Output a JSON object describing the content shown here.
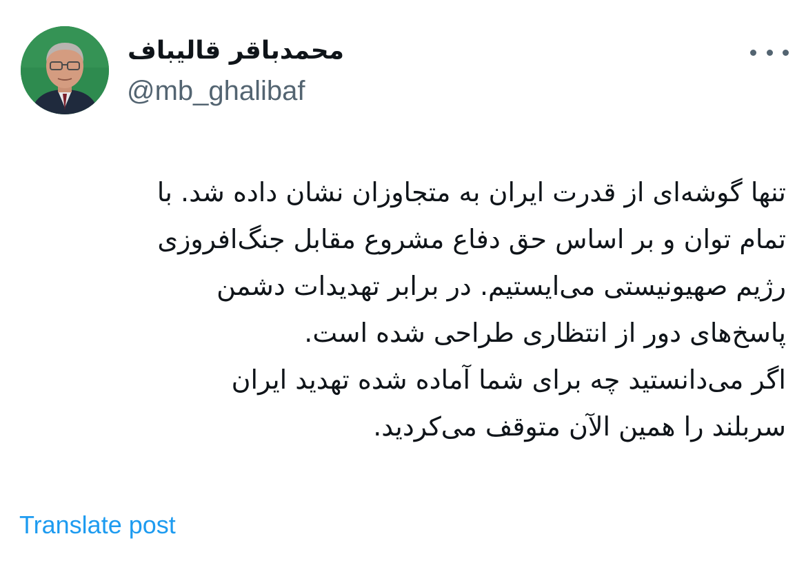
{
  "author": {
    "display_name": "محمدباقر قالیباف",
    "handle": "@mb_ghalibaf",
    "avatar": "profile-photo"
  },
  "post": {
    "lines": [
      "تنها گوشه‌ای از قدرت ایران به متجاوزان نشان داده شد. با",
      "تمام توان و بر اساس حق دفاع مشروع مقابل جنگ‌افروزی",
      "رژیم صهیونیستی می‌ایستیم. در برابر تهدیدات دشمن",
      "پاسخ‌های دور از انتظاری طراحی شده است.",
      "اگر می‌دانستید چه برای شما آماده شده تهدید ایران",
      "سربلند را همین الآن متوقف می‌کردید."
    ]
  },
  "actions": {
    "more_icon": "more-horizontal-icon",
    "translate_label": "Translate post"
  },
  "colors": {
    "text": "#0f1419",
    "secondary": "#536471",
    "link": "#1d9bf0",
    "avatar_bg": "#2e8b4f"
  }
}
